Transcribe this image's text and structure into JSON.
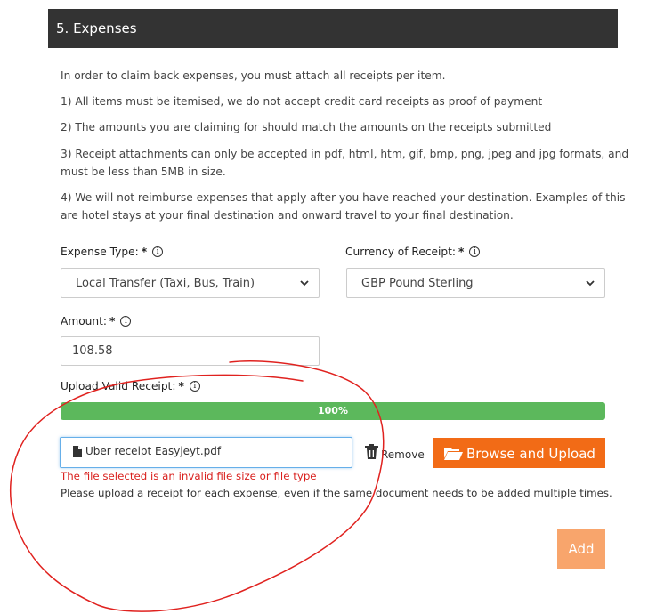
{
  "section": {
    "title": "5. Expenses"
  },
  "instructions": {
    "intro": "In order to claim back expenses, you must attach all receipts per item.",
    "items": [
      "1) All items must be itemised, we do not accept credit card receipts as proof of payment",
      "2) The amounts you are claiming for should match the amounts on the receipts submitted",
      "3) Receipt attachments can only be accepted in pdf, html, htm, gif, bmp, png, jpeg and jpg formats, and",
      "must be less than 5MB in size.",
      "4) We will not reimburse expenses that apply after you have reached your destination. Examples of this",
      "are hotel stays at your final destination and onward travel to your final destination."
    ]
  },
  "form": {
    "expense_type": {
      "label": "Expense Type:",
      "required": "*",
      "value": "Local Transfer (Taxi, Bus, Train)"
    },
    "currency": {
      "label": "Currency of Receipt:",
      "required": "*",
      "value": "GBP Pound Sterling"
    },
    "amount": {
      "label": "Amount:",
      "required": "*",
      "value": "108.58"
    },
    "receipt": {
      "label": "Upload Valid Receipt:",
      "required": "*",
      "progress_label": "100%",
      "progress": 1.0,
      "file_name": "Uber receipt Easyjeyt.pdf",
      "remove_label": "Remove",
      "browse_label": "Browse and Upload",
      "error": "The file selected is an invalid file size or file type",
      "help": "Please upload a receipt for each expense, even if the same document needs to be added multiple times."
    },
    "add_label": "Add",
    "info_glyph": "i"
  },
  "colors": {
    "header_bg": "#333333",
    "progress": "#5cb85c",
    "primary_button": "#f26b16",
    "disabled_button": "#f8a56c",
    "error": "#d9211f",
    "annotation": "#e0221f"
  }
}
